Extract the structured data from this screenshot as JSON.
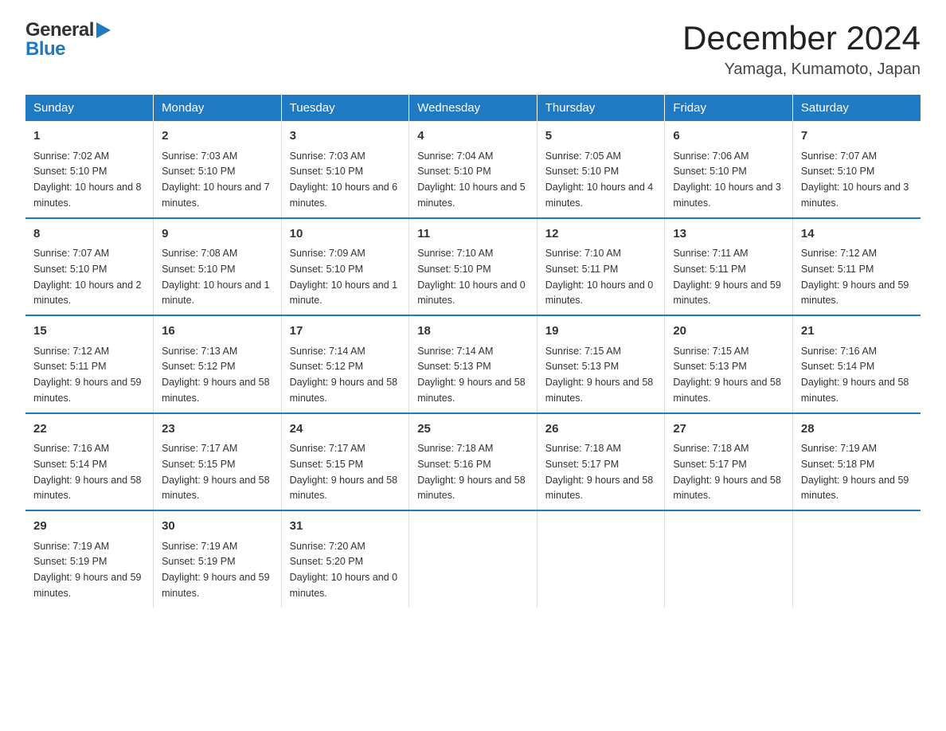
{
  "header": {
    "title": "December 2024",
    "subtitle": "Yamaga, Kumamoto, Japan"
  },
  "logo": {
    "general": "General",
    "blue": "Blue"
  },
  "columns": [
    "Sunday",
    "Monday",
    "Tuesday",
    "Wednesday",
    "Thursday",
    "Friday",
    "Saturday"
  ],
  "weeks": [
    [
      {
        "day": "1",
        "sunrise": "7:02 AM",
        "sunset": "5:10 PM",
        "daylight": "10 hours and 8 minutes."
      },
      {
        "day": "2",
        "sunrise": "7:03 AM",
        "sunset": "5:10 PM",
        "daylight": "10 hours and 7 minutes."
      },
      {
        "day": "3",
        "sunrise": "7:03 AM",
        "sunset": "5:10 PM",
        "daylight": "10 hours and 6 minutes."
      },
      {
        "day": "4",
        "sunrise": "7:04 AM",
        "sunset": "5:10 PM",
        "daylight": "10 hours and 5 minutes."
      },
      {
        "day": "5",
        "sunrise": "7:05 AM",
        "sunset": "5:10 PM",
        "daylight": "10 hours and 4 minutes."
      },
      {
        "day": "6",
        "sunrise": "7:06 AM",
        "sunset": "5:10 PM",
        "daylight": "10 hours and 3 minutes."
      },
      {
        "day": "7",
        "sunrise": "7:07 AM",
        "sunset": "5:10 PM",
        "daylight": "10 hours and 3 minutes."
      }
    ],
    [
      {
        "day": "8",
        "sunrise": "7:07 AM",
        "sunset": "5:10 PM",
        "daylight": "10 hours and 2 minutes."
      },
      {
        "day": "9",
        "sunrise": "7:08 AM",
        "sunset": "5:10 PM",
        "daylight": "10 hours and 1 minute."
      },
      {
        "day": "10",
        "sunrise": "7:09 AM",
        "sunset": "5:10 PM",
        "daylight": "10 hours and 1 minute."
      },
      {
        "day": "11",
        "sunrise": "7:10 AM",
        "sunset": "5:10 PM",
        "daylight": "10 hours and 0 minutes."
      },
      {
        "day": "12",
        "sunrise": "7:10 AM",
        "sunset": "5:11 PM",
        "daylight": "10 hours and 0 minutes."
      },
      {
        "day": "13",
        "sunrise": "7:11 AM",
        "sunset": "5:11 PM",
        "daylight": "9 hours and 59 minutes."
      },
      {
        "day": "14",
        "sunrise": "7:12 AM",
        "sunset": "5:11 PM",
        "daylight": "9 hours and 59 minutes."
      }
    ],
    [
      {
        "day": "15",
        "sunrise": "7:12 AM",
        "sunset": "5:11 PM",
        "daylight": "9 hours and 59 minutes."
      },
      {
        "day": "16",
        "sunrise": "7:13 AM",
        "sunset": "5:12 PM",
        "daylight": "9 hours and 58 minutes."
      },
      {
        "day": "17",
        "sunrise": "7:14 AM",
        "sunset": "5:12 PM",
        "daylight": "9 hours and 58 minutes."
      },
      {
        "day": "18",
        "sunrise": "7:14 AM",
        "sunset": "5:13 PM",
        "daylight": "9 hours and 58 minutes."
      },
      {
        "day": "19",
        "sunrise": "7:15 AM",
        "sunset": "5:13 PM",
        "daylight": "9 hours and 58 minutes."
      },
      {
        "day": "20",
        "sunrise": "7:15 AM",
        "sunset": "5:13 PM",
        "daylight": "9 hours and 58 minutes."
      },
      {
        "day": "21",
        "sunrise": "7:16 AM",
        "sunset": "5:14 PM",
        "daylight": "9 hours and 58 minutes."
      }
    ],
    [
      {
        "day": "22",
        "sunrise": "7:16 AM",
        "sunset": "5:14 PM",
        "daylight": "9 hours and 58 minutes."
      },
      {
        "day": "23",
        "sunrise": "7:17 AM",
        "sunset": "5:15 PM",
        "daylight": "9 hours and 58 minutes."
      },
      {
        "day": "24",
        "sunrise": "7:17 AM",
        "sunset": "5:15 PM",
        "daylight": "9 hours and 58 minutes."
      },
      {
        "day": "25",
        "sunrise": "7:18 AM",
        "sunset": "5:16 PM",
        "daylight": "9 hours and 58 minutes."
      },
      {
        "day": "26",
        "sunrise": "7:18 AM",
        "sunset": "5:17 PM",
        "daylight": "9 hours and 58 minutes."
      },
      {
        "day": "27",
        "sunrise": "7:18 AM",
        "sunset": "5:17 PM",
        "daylight": "9 hours and 58 minutes."
      },
      {
        "day": "28",
        "sunrise": "7:19 AM",
        "sunset": "5:18 PM",
        "daylight": "9 hours and 59 minutes."
      }
    ],
    [
      {
        "day": "29",
        "sunrise": "7:19 AM",
        "sunset": "5:19 PM",
        "daylight": "9 hours and 59 minutes."
      },
      {
        "day": "30",
        "sunrise": "7:19 AM",
        "sunset": "5:19 PM",
        "daylight": "9 hours and 59 minutes."
      },
      {
        "day": "31",
        "sunrise": "7:20 AM",
        "sunset": "5:20 PM",
        "daylight": "10 hours and 0 minutes."
      },
      null,
      null,
      null,
      null
    ]
  ]
}
